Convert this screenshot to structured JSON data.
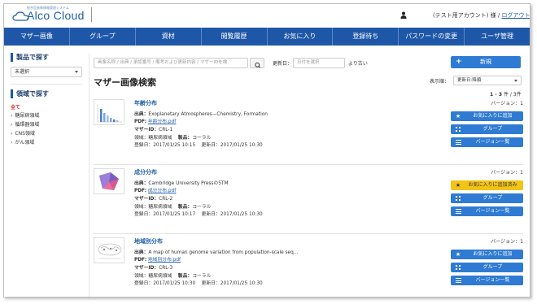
{
  "header": {
    "logo_small": "統合型画像情報管理システム",
    "logo_text": "Alco Cloud",
    "user_text": "(テスト用アカウント) 様 /",
    "logout": "ログアウト"
  },
  "nav": [
    "マザー画像",
    "グループ",
    "資材",
    "閲覧履歴",
    "お気に入り",
    "登録待ち",
    "パスワードの変更",
    "ユーザ管理"
  ],
  "sidebar": {
    "product_title": "製品で探す",
    "product_value": "未選択",
    "field_title": "領域で探す",
    "all_label": "全て",
    "fields": [
      "糖尿病領域",
      "循環器領域",
      "CNS領域",
      "がん領域"
    ]
  },
  "search": {
    "placeholder": "画像名称 / 出典 / 承認番号 / 備考および更新内容 / マザーIDを検",
    "date_label": "更新日：",
    "date_placeholder": "日付を選択",
    "date_after": "より古い",
    "new_button": "新規"
  },
  "main": {
    "title": "マザー画像検索",
    "sort_label": "表示順：",
    "sort_value": "更新日:降順",
    "count_range": "1 - 3",
    "count_unit": "件 / 3件"
  },
  "labels": {
    "source": "出典：",
    "pdf": "PDF:",
    "mother_id": "マザーID：",
    "field": "領域：",
    "product": "製品：",
    "registered": "登録日：",
    "updated": "更新日：",
    "version": "バージョン："
  },
  "items": [
    {
      "title": "年齢分布",
      "source": "Exoplanetary Atmospheres—Chemistry, Formation",
      "pdf": "年齢分布.pdf",
      "mother_id": "CRL-1",
      "field": "糖尿病領域",
      "product": "コーラル",
      "registered": "2017/01/25 10:15",
      "updated": "2017/01/25 10:30",
      "version": "1",
      "fav_label": "お気に入りに追加",
      "fav_added": false,
      "group_label": "グループ",
      "versions_label": "バージョン一覧"
    },
    {
      "title": "成分分布",
      "source": "Cambridge University Pressの5TM",
      "pdf": "成分分布.pdf",
      "mother_id": "CRL-2",
      "field": "糖尿病領域",
      "product": "コーラル",
      "registered": "2017/01/25 10:17",
      "updated": "2017/01/25 10:30",
      "version": "1",
      "fav_label": "お気に入りに追加済み",
      "fav_added": true,
      "group_label": "グループ",
      "versions_label": "バージョン一覧"
    },
    {
      "title": "地域別分布",
      "source": "A map of human genome variation from population-scale seq…",
      "pdf": "地域別分布.pdf",
      "mother_id": "CRL-3",
      "field": "糖尿病領域",
      "product": "コーラル",
      "registered": "2017/01/25 10:30",
      "updated": "2017/01/25 10:30",
      "version": "1",
      "fav_label": "お気に入りに追加",
      "fav_added": false,
      "group_label": "グループ",
      "versions_label": "バージョン一覧"
    }
  ],
  "colors": {
    "nav": "#1f57a8",
    "button_blue": "#2f7bd3",
    "button_yellow": "#f3c316",
    "link": "#1f5fa8",
    "all_red": "#d9261c"
  }
}
